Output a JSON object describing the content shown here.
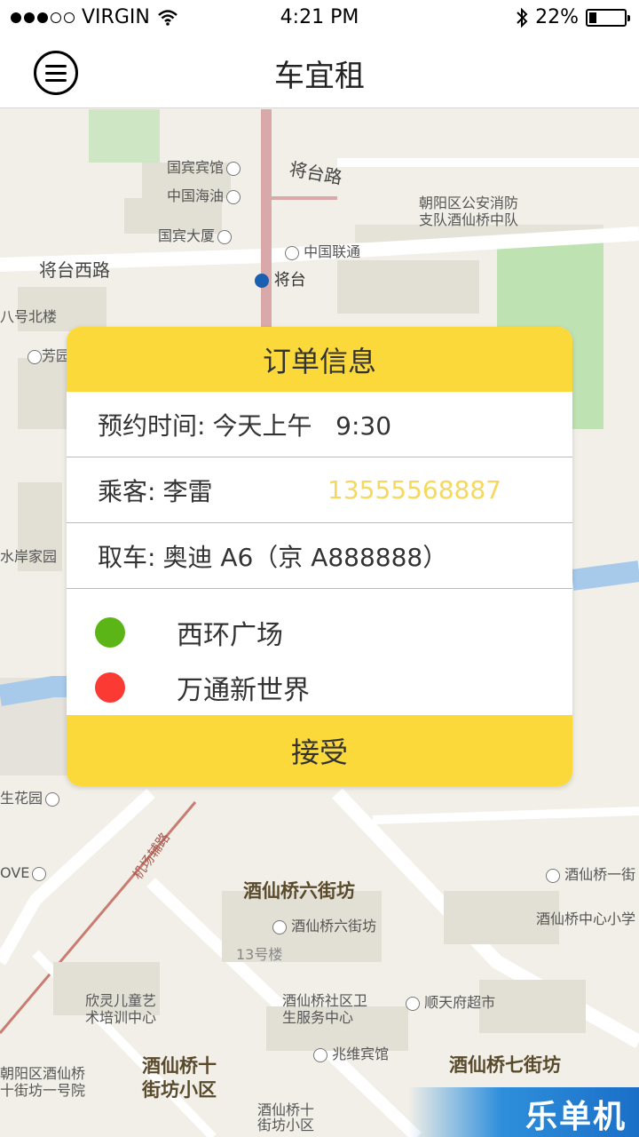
{
  "status_bar": {
    "carrier": "VIRGIN",
    "time": "4:21 PM",
    "battery": "22%",
    "battery_level": 0.22
  },
  "nav": {
    "title": "车宜租"
  },
  "map": {
    "labels": {
      "guobin_hotel": "国宾宾馆",
      "zhongguo_haiyou": "中国海油",
      "guobin_dasha": "国宾大厦",
      "jiangtai_road": "将台路",
      "jiangtai_west_road": "将台西路",
      "jiangtai_station": "将台",
      "china_unicom": "中国联通",
      "fire_station": "朝阳区公安消防\n支队酒仙桥中队",
      "bahao_north": "八号北楼",
      "fang_yuan": "芳园",
      "shuian_jiayuan": "水岸家园",
      "shenghuayuan": "生花园",
      "jiuxianqiao_6": "酒仙桥六街坊",
      "jiuxianqiao_6_poi": "酒仙桥六街坊",
      "building_13": "13号楼",
      "xinling_art": "欣灵儿童艺\n术培训中心",
      "health_center": "酒仙桥社区卫\n生服务中心",
      "shuntianfu": "顺天府超市",
      "zhaowei_hotel": "兆维宾馆",
      "jiuxianqiao_10": "酒仙桥十\n街坊小区",
      "jiuxianqiao_7": "酒仙桥七街坊",
      "jiuxianqiao_10_poi": "酒仙桥十\n街坊小区",
      "chaoyang_jiuxianqiao": "朝阳区酒仙桥\n十街坊一号院",
      "jiuxianqiao_1": "酒仙桥一街",
      "jiuxianqiao_center": "酒仙桥中心小学",
      "ove": "OVE",
      "road_shu": "机场辅路"
    },
    "watermark": "乐单机"
  },
  "order": {
    "title": "订单信息",
    "time_label": "预约时间:",
    "time_value": "今天上午   9:30",
    "passenger_label": "乘客:",
    "passenger_name": "李雷",
    "passenger_phone": "13555568887",
    "pickup_label": "取车:",
    "pickup_value": "奥迪 A6（京 A888888）",
    "start": "西环广场",
    "end": "万通新世界",
    "start_color": "#5cb516",
    "end_color": "#fb3a33",
    "accept_label": "接受"
  }
}
